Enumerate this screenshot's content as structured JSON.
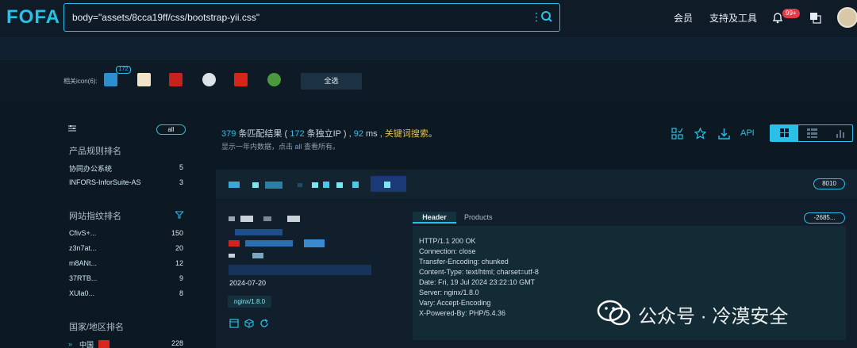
{
  "header": {
    "logo": "FOFA",
    "search_query": "body=\"assets/8cca19ff/css/bootstrap-yii.css\"",
    "nav_member": "会员",
    "nav_tools": "支持及工具",
    "notif_badge": "99+"
  },
  "icons": {
    "label": "相关icon(6):",
    "first_count": "172",
    "select_all": "全选"
  },
  "sidebar": {
    "all_label": "all",
    "product_title": "产品规则排名",
    "products": [
      {
        "name": "协同办公系统",
        "count": "5"
      },
      {
        "name": "INFORS-InforSuite-AS",
        "count": "3"
      }
    ],
    "fingerprint_title": "网站指纹排名",
    "fingerprints": [
      {
        "name": "CfivS+...",
        "count": "150"
      },
      {
        "name": "z3n7at...",
        "count": "20"
      },
      {
        "name": "m8ANt...",
        "count": "12"
      },
      {
        "name": "37RTB...",
        "count": "9"
      },
      {
        "name": "XUla0...",
        "count": "8"
      }
    ],
    "country_title": "国家/地区排名",
    "countries": [
      {
        "name": "中国",
        "count": "228"
      }
    ]
  },
  "summary": {
    "count": "379",
    "text_a": " 条匹配结果 ( ",
    "ip_count": "172",
    "text_b": " 条独立IP ) , ",
    "ms": "92",
    "text_c": " ms , ",
    "keyword": "关键词搜索",
    "text_d": "。",
    "sub_a": "显示一年内数据，点击 ",
    "sub_all": "all",
    "sub_b": " 查看所有。",
    "api": "API"
  },
  "result": {
    "port": "8010",
    "date": "2024-07-20",
    "server_tag": "nginx/1.8.0",
    "tab_header": "Header",
    "tab_products": "Products",
    "hash": "-2685...",
    "response": [
      "HTTP/1.1 200 OK",
      "Connection: close",
      "Transfer-Encoding: chunked",
      "Content-Type: text/html; charset=utf-8",
      "Date: Fri, 19 Jul 2024 23:22:10 GMT",
      "Server: nginx/1.8.0",
      "Vary: Accept-Encoding",
      "X-Powered-By: PHP/5.4.36"
    ]
  },
  "watermark": "公众号 · 冷漠安全",
  "colors": {
    "accent": "#2bc0e8",
    "keyword": "#e8c34a",
    "badge": "#e33b4a"
  }
}
